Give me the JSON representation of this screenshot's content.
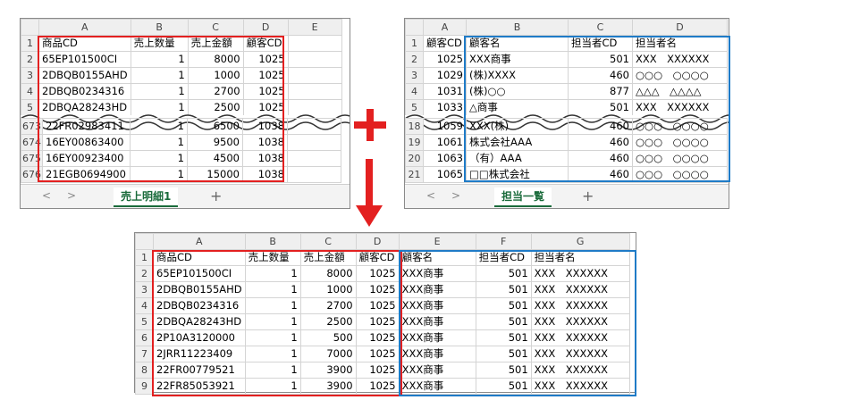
{
  "colors": {
    "red": "#e32020",
    "blue": "#1f7bc7",
    "header_bg": "#efefef",
    "tab_green": "#1a6b3b"
  },
  "sales": {
    "col_headers": [
      "A",
      "B",
      "C",
      "D",
      "E"
    ],
    "top_rows": [
      {
        "n": "1",
        "a": "商品CD",
        "b": "売上数量",
        "c": "売上金額",
        "d": "顧客CD"
      },
      {
        "n": "2",
        "a": "65EP101500CI",
        "b": "1",
        "c": "8000",
        "d": "1025"
      },
      {
        "n": "3",
        "a": "2DBQB0155AHD",
        "b": "1",
        "c": "1000",
        "d": "1025"
      },
      {
        "n": "4",
        "a": "2DBQB0234316",
        "b": "1",
        "c": "2700",
        "d": "1025"
      },
      {
        "n": "5",
        "a": "2DBQA28243HD",
        "b": "1",
        "c": "2500",
        "d": "1025"
      }
    ],
    "bottom_rows": [
      {
        "n": "673",
        "a": "22FR02983411",
        "b": "1",
        "c": "6500",
        "d": "1038"
      },
      {
        "n": "674",
        "a": "16EY00863400",
        "b": "1",
        "c": "9500",
        "d": "1038"
      },
      {
        "n": "675",
        "a": "16EY00923400",
        "b": "1",
        "c": "4500",
        "d": "1038"
      },
      {
        "n": "676",
        "a": "21EGB0694900",
        "b": "1",
        "c": "15000",
        "d": "1038"
      }
    ],
    "tab_label": "売上明細1",
    "nav_prev": "<",
    "nav_next": ">",
    "add_tab": "+"
  },
  "customers": {
    "col_headers": [
      "A",
      "B",
      "C",
      "D"
    ],
    "top_rows": [
      {
        "n": "1",
        "a": "顧客CD",
        "b": "顧客名",
        "c": "担当者CD",
        "d": "担当者名"
      },
      {
        "n": "2",
        "a": "1025",
        "b": "XXX商事",
        "c": "501",
        "d": "XXX　XXXXXX"
      },
      {
        "n": "3",
        "a": "1029",
        "b": "(株)XXXX",
        "c": "460",
        "d": "○○○　○○○○"
      },
      {
        "n": "4",
        "a": "1031",
        "b": "(株)○○",
        "c": "877",
        "d": "△△△　△△△△"
      },
      {
        "n": "5",
        "a": "1033",
        "b": "△商事",
        "c": "501",
        "d": "XXX　XXXXXX"
      }
    ],
    "bottom_rows": [
      {
        "n": "18",
        "a": "1059",
        "b": "XXX(株)",
        "c": "460",
        "d": "○○○　○○○○"
      },
      {
        "n": "19",
        "a": "1061",
        "b": "株式会社AAA",
        "c": "460",
        "d": "○○○　○○○○"
      },
      {
        "n": "20",
        "a": "1063",
        "b": "（有）AAA",
        "c": "460",
        "d": "○○○　○○○○"
      },
      {
        "n": "21",
        "a": "1065",
        "b": "□□株式会社",
        "c": "460",
        "d": "○○○　○○○○"
      }
    ],
    "tab_label": "担当一覧",
    "nav_prev": "<",
    "nav_next": ">",
    "add_tab": "+"
  },
  "plus_sign": "+",
  "result": {
    "col_headers": [
      "A",
      "B",
      "C",
      "D",
      "E",
      "F",
      "G"
    ],
    "rows": [
      {
        "n": "1",
        "a": "商品CD",
        "b": "売上数量",
        "c": "売上金額",
        "d": "顧客CD",
        "e": "顧客名",
        "f": "担当者CD",
        "g": "担当者名"
      },
      {
        "n": "2",
        "a": "65EP101500CI",
        "b": "1",
        "c": "8000",
        "d": "1025",
        "e": "XXX商事",
        "f": "501",
        "g": "XXX　XXXXXX"
      },
      {
        "n": "3",
        "a": "2DBQB0155AHD",
        "b": "1",
        "c": "1000",
        "d": "1025",
        "e": "XXX商事",
        "f": "501",
        "g": "XXX　XXXXXX"
      },
      {
        "n": "4",
        "a": "2DBQB0234316",
        "b": "1",
        "c": "2700",
        "d": "1025",
        "e": "XXX商事",
        "f": "501",
        "g": "XXX　XXXXXX"
      },
      {
        "n": "5",
        "a": "2DBQA28243HD",
        "b": "1",
        "c": "2500",
        "d": "1025",
        "e": "XXX商事",
        "f": "501",
        "g": "XXX　XXXXXX"
      },
      {
        "n": "6",
        "a": "2P10A3120000",
        "b": "1",
        "c": "500",
        "d": "1025",
        "e": "XXX商事",
        "f": "501",
        "g": "XXX　XXXXXX"
      },
      {
        "n": "7",
        "a": "2JRR11223409",
        "b": "1",
        "c": "7000",
        "d": "1025",
        "e": "XXX商事",
        "f": "501",
        "g": "XXX　XXXXXX"
      },
      {
        "n": "8",
        "a": "22FR00779521",
        "b": "1",
        "c": "3900",
        "d": "1025",
        "e": "XXX商事",
        "f": "501",
        "g": "XXX　XXXXXX"
      },
      {
        "n": "9",
        "a": "22FR85053921",
        "b": "1",
        "c": "3900",
        "d": "1025",
        "e": "XXX商事",
        "f": "501",
        "g": "XXX　XXXXXX"
      }
    ]
  }
}
